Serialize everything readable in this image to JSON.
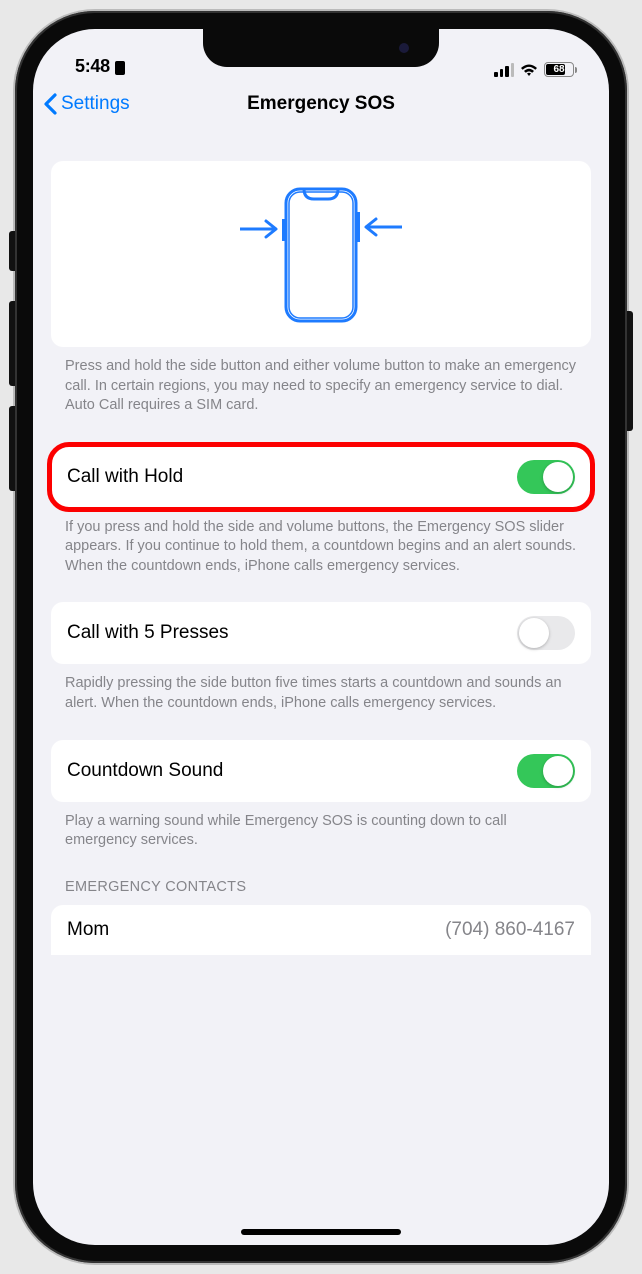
{
  "status": {
    "time": "5:48",
    "battery_pct": "68"
  },
  "nav": {
    "back": "Settings",
    "title": "Emergency SOS"
  },
  "illustration_footer": "Press and hold the side button and either volume button to make an emergency call. In certain regions, you may need to specify an emergency service to dial. Auto Call requires a SIM card.",
  "call_with_hold": {
    "label": "Call with Hold",
    "footer": "If you press and hold the side and volume buttons, the Emergency SOS slider appears. If you continue to hold them, a countdown begins and an alert sounds. When the countdown ends, iPhone calls emergency services."
  },
  "call_with_5": {
    "label": "Call with 5 Presses",
    "footer": "Rapidly pressing the side button five times starts a countdown and sounds an alert. When the countdown ends, iPhone calls emergency services."
  },
  "countdown_sound": {
    "label": "Countdown Sound",
    "footer": "Play a warning sound while Emergency SOS is counting down to call emergency services."
  },
  "emergency_contacts": {
    "header": "EMERGENCY CONTACTS",
    "items": [
      {
        "name": "Mom",
        "phone": "(704) 860-4167"
      }
    ]
  }
}
